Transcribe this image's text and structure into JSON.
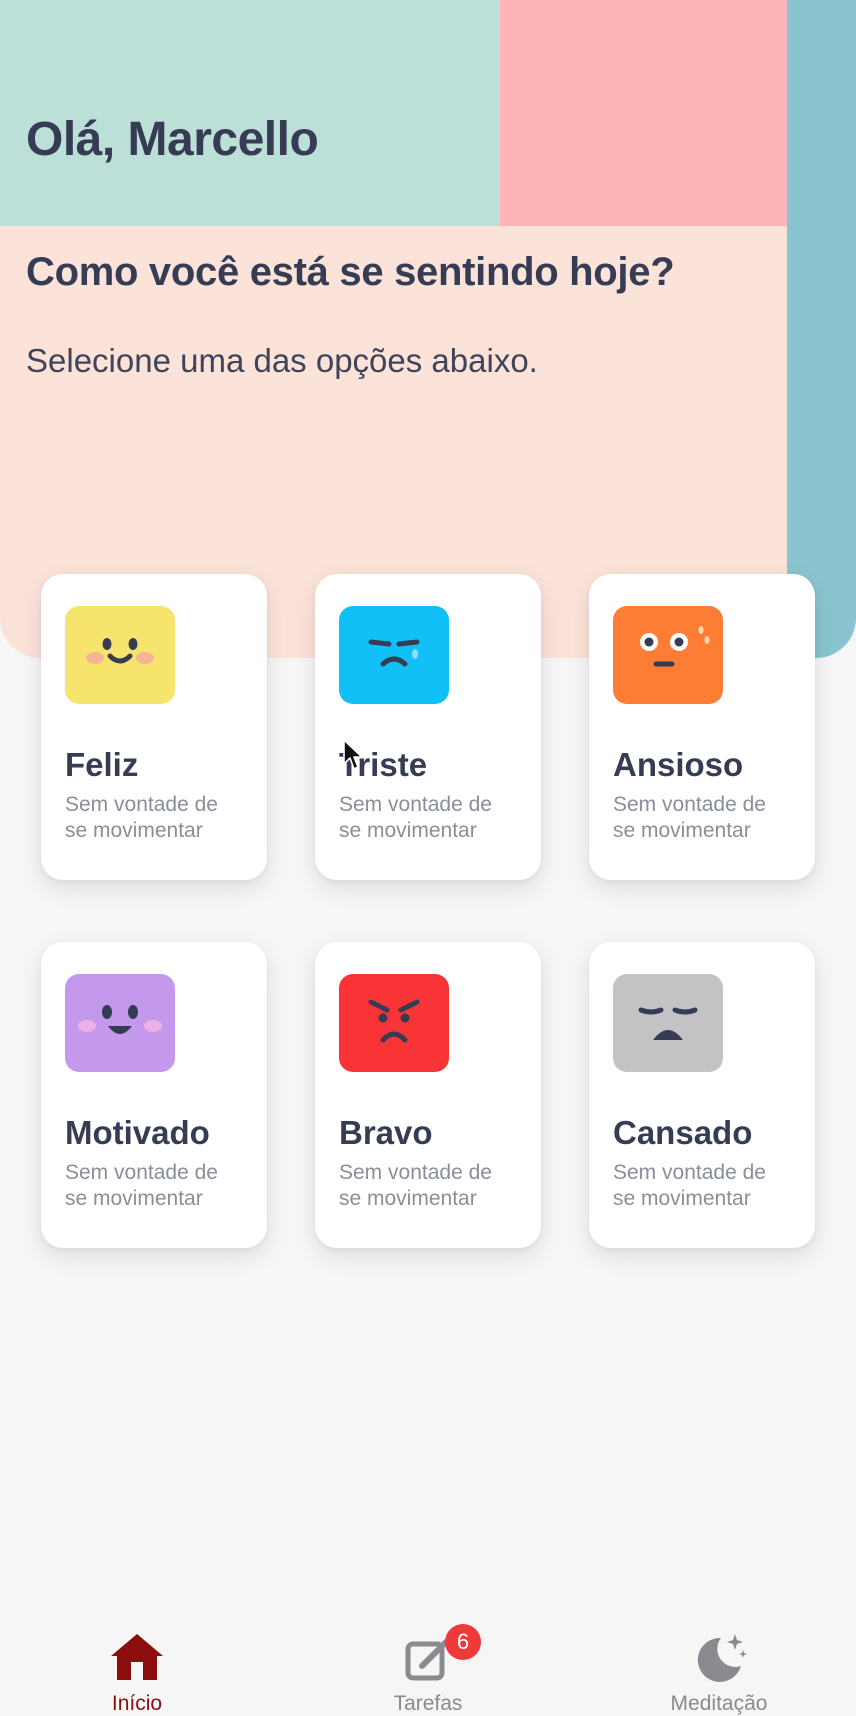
{
  "header": {
    "greeting": "Olá, Marcello",
    "question": "Como você está se sentindo hoje?",
    "subtitle": "Selecione uma das opções abaixo."
  },
  "colors": {
    "mint": "#bcdfd7",
    "pink": "#ffb5b8",
    "teal": "#8ac4cf",
    "peach": "#fbe3da",
    "tab_active": "#8b0d0d",
    "badge": "#f03a3a"
  },
  "moods": [
    {
      "label": "Feliz",
      "description": "Sem vontade de se movimentar",
      "color": "#f6e46c",
      "icon": "happy-face-icon"
    },
    {
      "label": "Triste",
      "description": "Sem vontade de se movimentar",
      "color": "#12c0f8",
      "icon": "sad-face-icon"
    },
    {
      "label": "Ansioso",
      "description": "Sem vontade de se movimentar",
      "color": "#fc7d33",
      "icon": "anxious-face-icon"
    },
    {
      "label": "Motivado",
      "description": "Sem vontade de se movimentar",
      "color": "#c499ec",
      "icon": "motivated-face-icon"
    },
    {
      "label": "Bravo",
      "description": "Sem vontade de se movimentar",
      "color": "#f83437",
      "icon": "angry-face-icon"
    },
    {
      "label": "Cansado",
      "description": "Sem vontade de se movimentar",
      "color": "#c3c2c5",
      "icon": "tired-face-icon"
    }
  ],
  "tabbar": {
    "tabs": [
      {
        "label": "Início",
        "icon": "home-icon",
        "active": true
      },
      {
        "label": "Tarefas",
        "icon": "edit-icon",
        "badge": "6"
      },
      {
        "label": "Meditação",
        "icon": "moon-icon"
      }
    ]
  }
}
